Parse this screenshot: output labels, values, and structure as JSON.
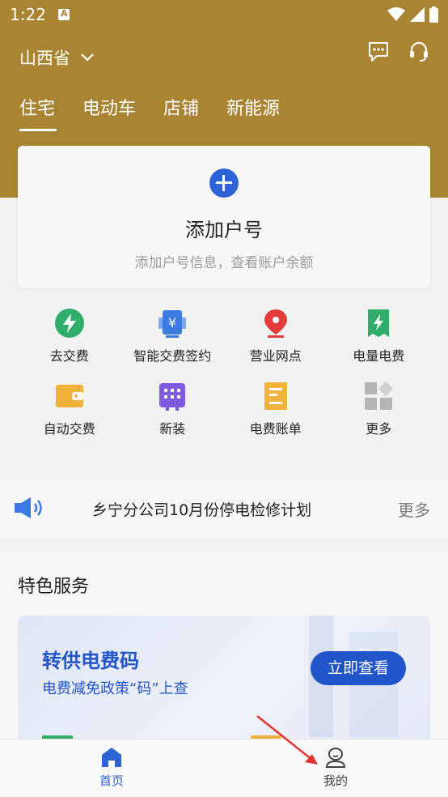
{
  "status_bar": {
    "time": "1:22"
  },
  "header": {
    "province": "山西省",
    "tabs": [
      {
        "label": "住宅",
        "active": true
      },
      {
        "label": "电动车",
        "active": false
      },
      {
        "label": "店铺",
        "active": false
      },
      {
        "label": "新能源",
        "active": false
      }
    ]
  },
  "add_card": {
    "title": "添加户号",
    "subtitle": "添加户号信息，查看账户余额"
  },
  "services": [
    {
      "label": "去交费",
      "icon": "lightning-icon",
      "color": "#2fae6a"
    },
    {
      "label": "智能交费签约",
      "icon": "yuan-device-icon",
      "color": "#3b7ae0"
    },
    {
      "label": "营业网点",
      "icon": "location-pin-icon",
      "color": "#e23c3c"
    },
    {
      "label": "电量电费",
      "icon": "lightning-ticket-icon",
      "color": "#2fae6a"
    },
    {
      "label": "自动交费",
      "icon": "wallet-icon",
      "color": "#f0b23a"
    },
    {
      "label": "新装",
      "icon": "meter-icon",
      "color": "#7d5ae0"
    },
    {
      "label": "电费账单",
      "icon": "bill-icon",
      "color": "#f0b23a"
    },
    {
      "label": "更多",
      "icon": "grid-more-icon",
      "color": "#b5b5b5"
    }
  ],
  "notice": {
    "text": "乡宁分公司10月份停电检修计划",
    "more_label": "更多"
  },
  "special_services": {
    "title": "特色服务",
    "promo": {
      "title": "转供电费码",
      "subtitle": "电费减免政策“码”上查",
      "button": "立即查看"
    }
  },
  "bottom_nav": [
    {
      "label": "首页",
      "active": true
    },
    {
      "label": "我的",
      "active": false
    }
  ],
  "colors": {
    "header_bg": "#a98533",
    "accent_blue": "#2e63d6",
    "annotation_arrow": "#e23232"
  }
}
